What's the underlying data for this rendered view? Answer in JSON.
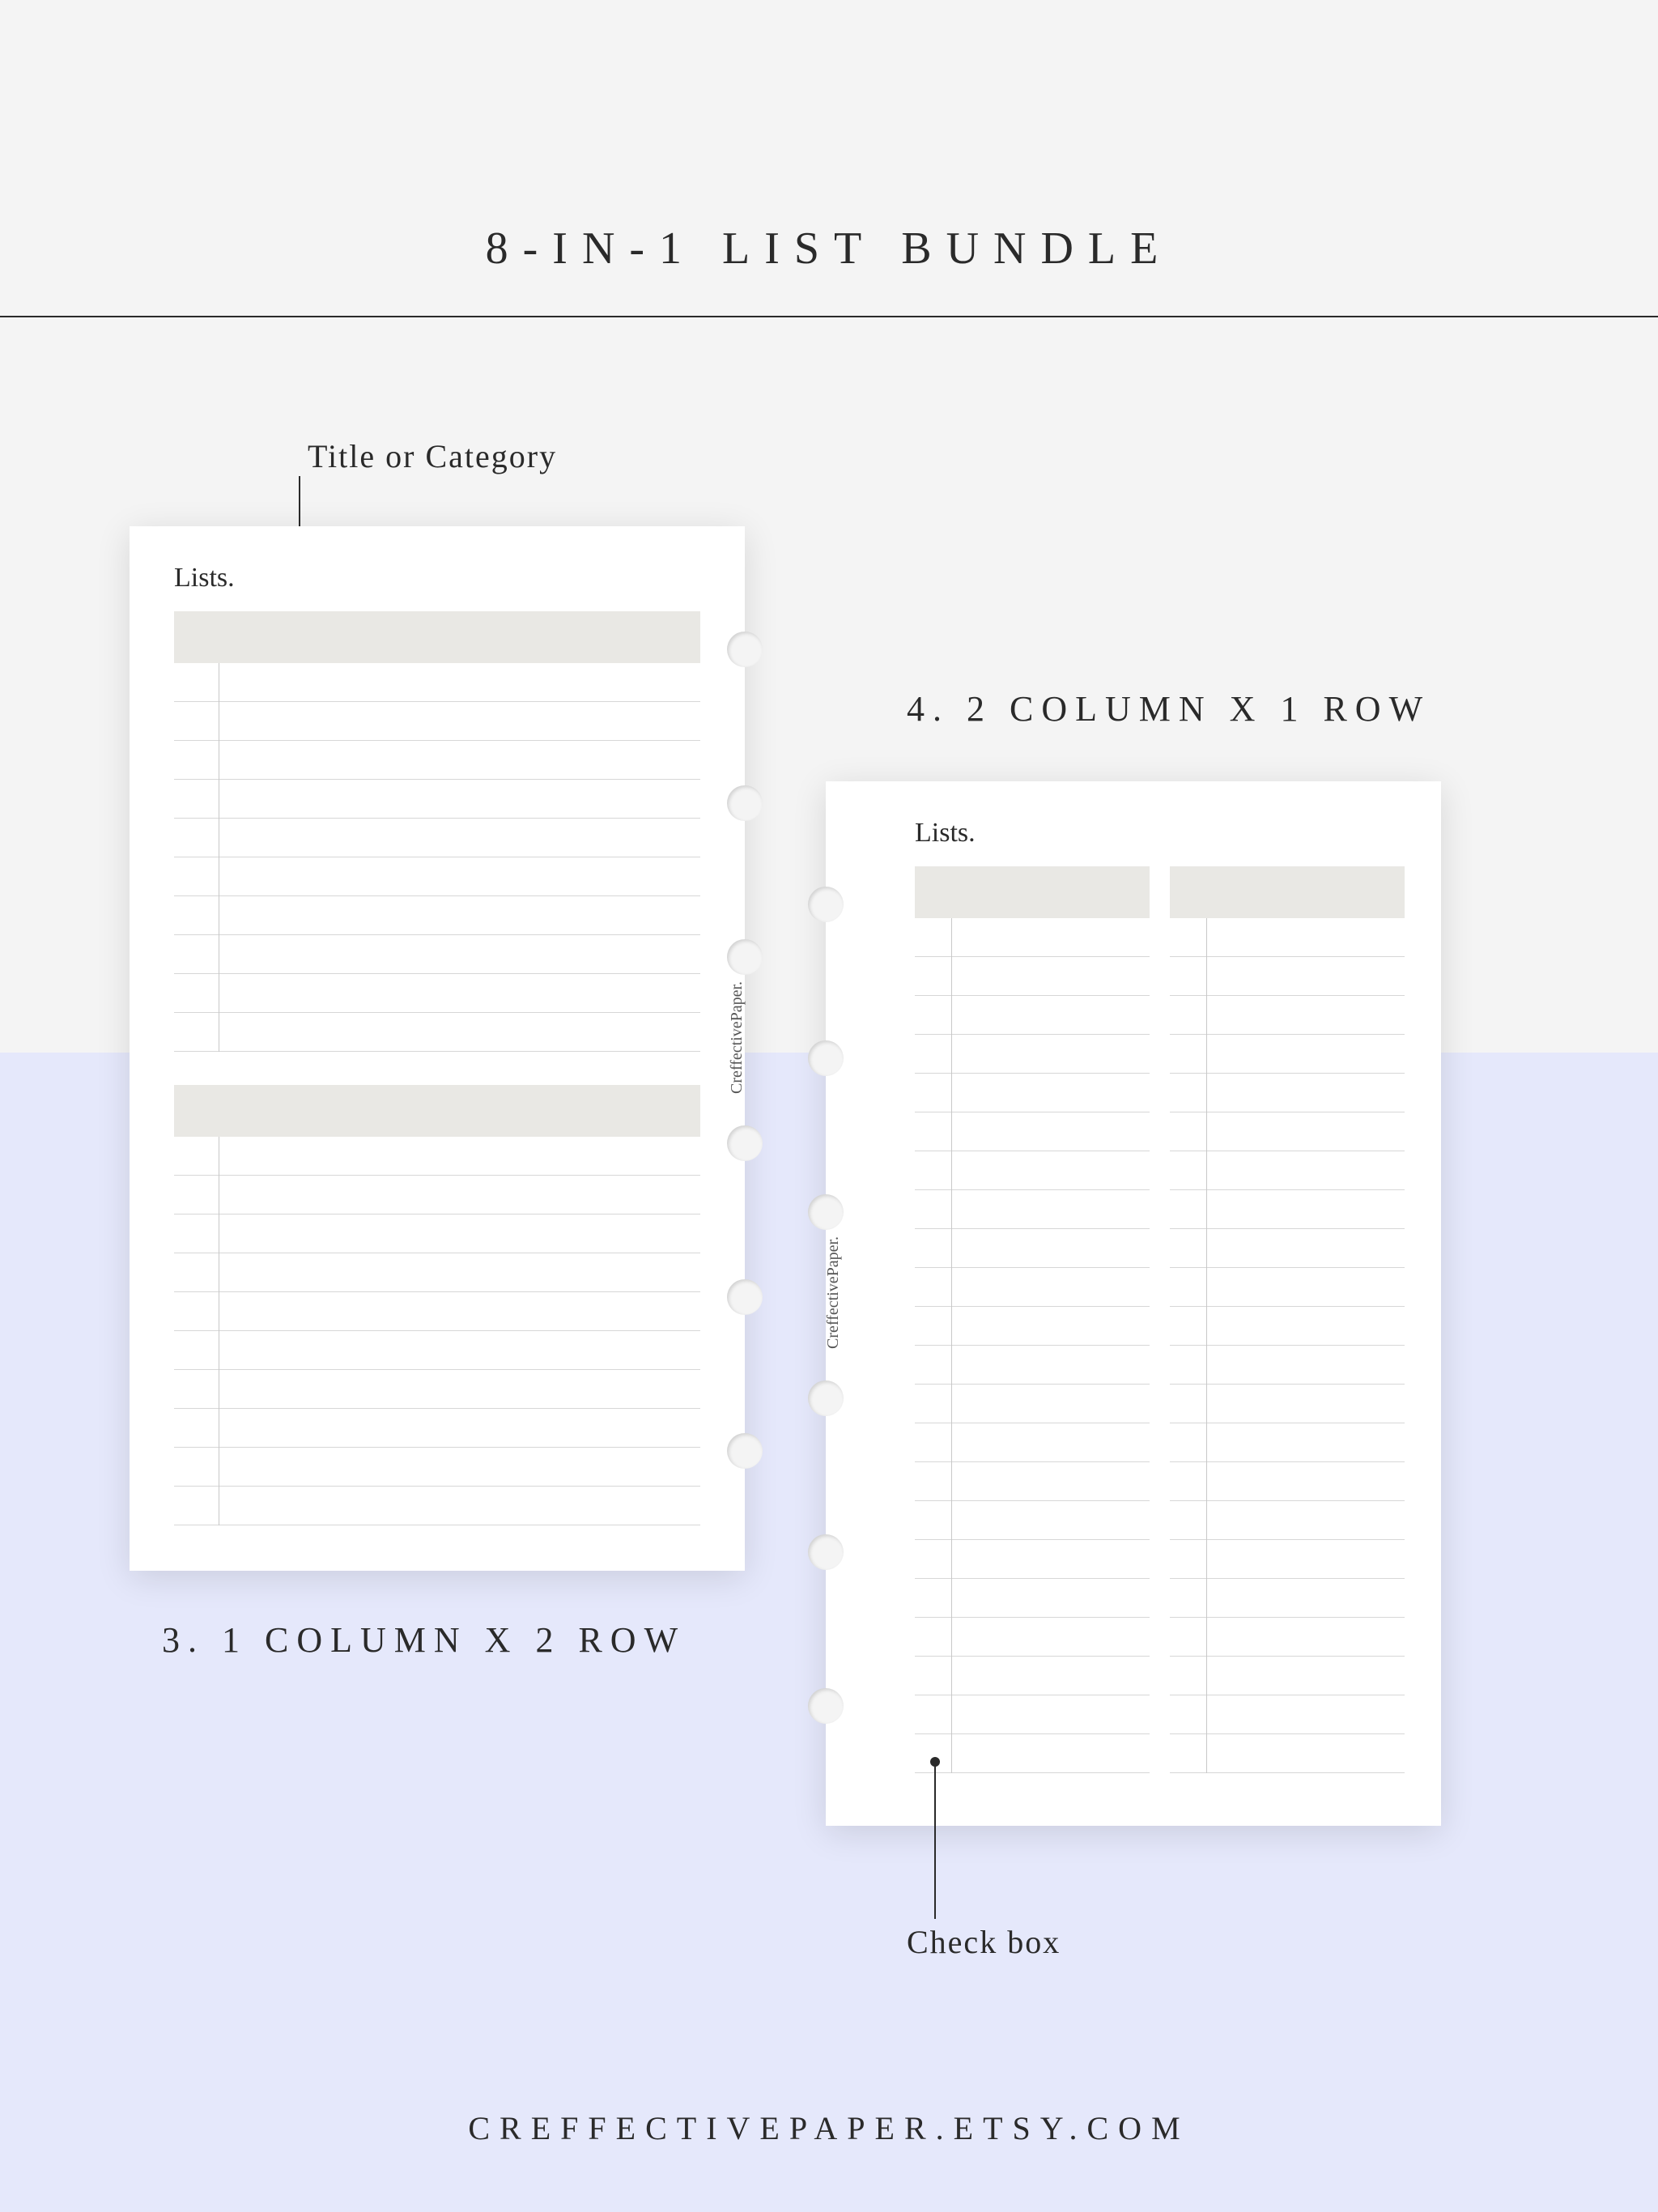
{
  "title": "8-IN-1 LIST BUNDLE",
  "annotations": {
    "title_or_category": "Title or Category",
    "check_box": "Check box"
  },
  "captions": {
    "left": "3. 1 COLUMN X 2 ROW",
    "right": "4. 2 COLUMN X 1 ROW"
  },
  "card": {
    "heading": "Lists.",
    "brand": "CreffectivePaper."
  },
  "footer": "CREFFECTIVEPAPER.ETSY.COM"
}
